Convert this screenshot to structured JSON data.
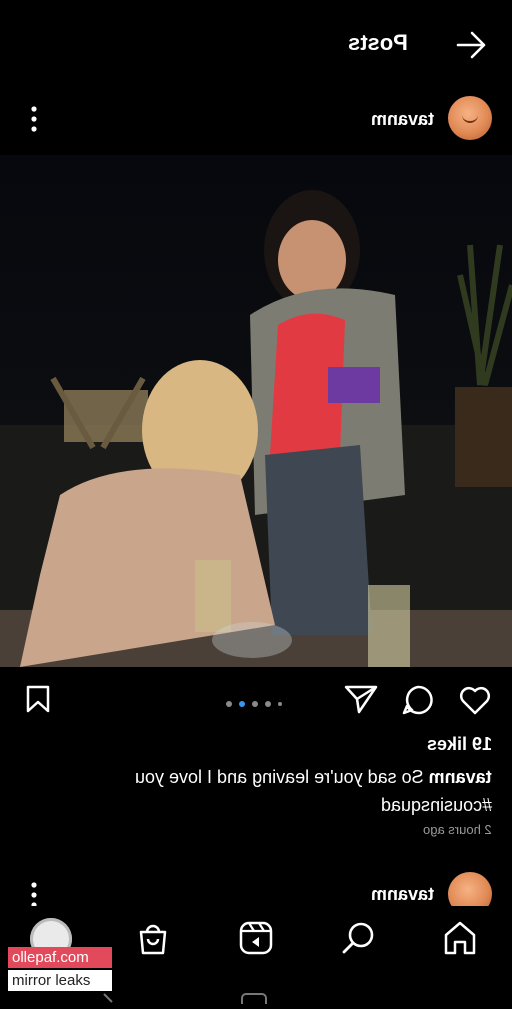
{
  "header": {
    "title": "Posts",
    "back_icon": "arrow-icon"
  },
  "post": {
    "username": "tavanm",
    "image_alt": "",
    "carousel": {
      "count": 5,
      "active_index": 1
    },
    "likes": "19 likes",
    "caption_user": "tavanm",
    "caption_text": "So sad you're leaving and I love you",
    "hashtag": "#cousinsquad",
    "time": "2 hours ago"
  },
  "next_post": {
    "username": "tavanm"
  },
  "nav": {
    "items": [
      "home-icon",
      "search-icon",
      "reels-icon",
      "shop-icon",
      "profile-avatar"
    ]
  },
  "watermark": {
    "line1": "ollepaf.com",
    "line2": "mirror leaks"
  },
  "colors": {
    "background": "#000000",
    "accent": "#3897f0",
    "watermark": "#e2495a"
  }
}
